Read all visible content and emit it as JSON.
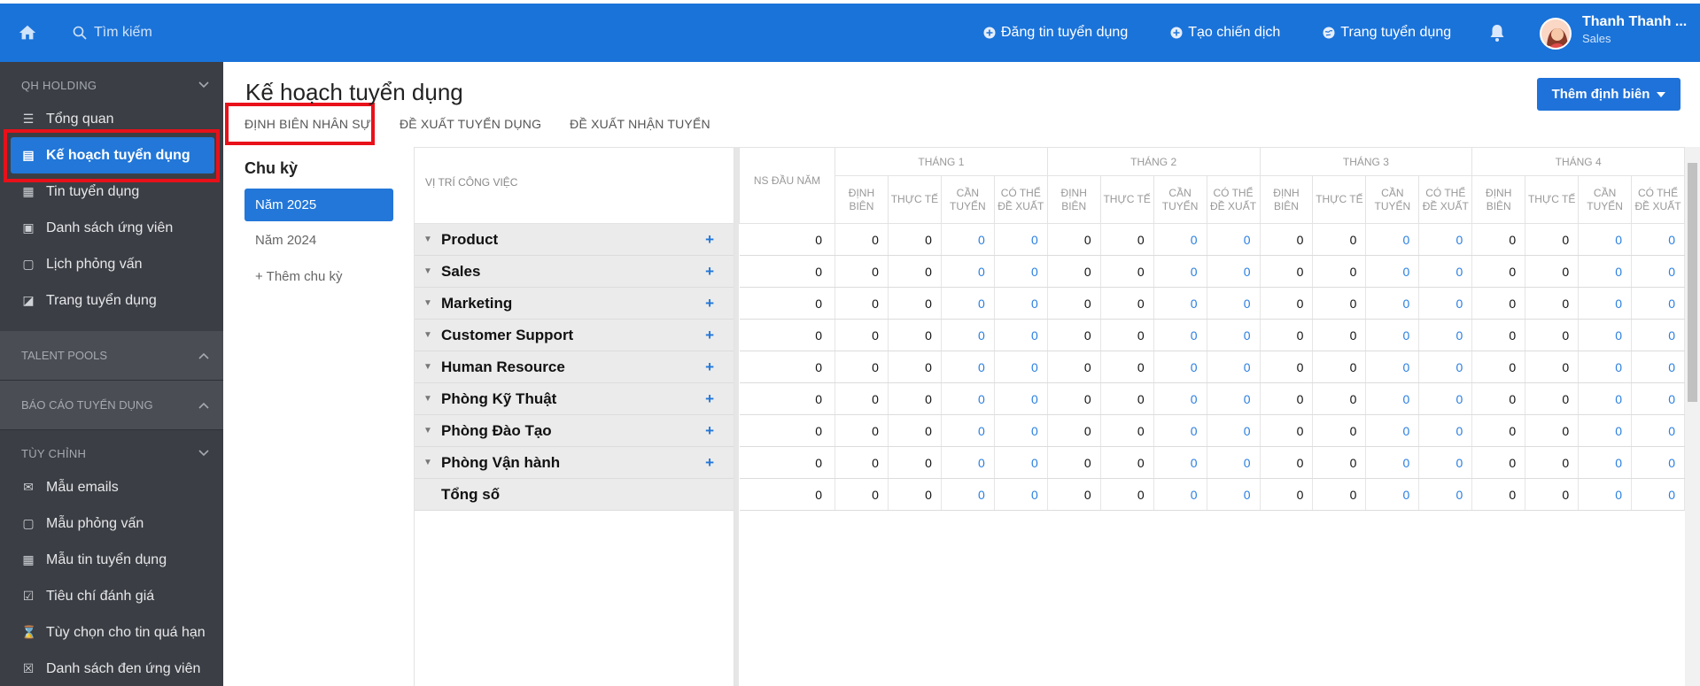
{
  "topbar": {
    "search_placeholder": "Tìm kiếm",
    "actions": [
      "Đăng tin tuyển dụng",
      "Tạo chiến dịch",
      "Trang tuyển dụng"
    ],
    "user_name": "Thanh Thanh ...",
    "user_role": "Sales"
  },
  "sidebar": {
    "group1": "QH HOLDING",
    "items1": [
      {
        "label": "Tổng quan",
        "icon": "list-icon"
      },
      {
        "label": "Kế hoạch tuyển dụng",
        "icon": "plan-icon"
      },
      {
        "label": "Tin tuyển dụng",
        "icon": "grid-icon"
      },
      {
        "label": "Danh sách ứng viên",
        "icon": "contact-icon"
      },
      {
        "label": "Lịch phỏng vấn",
        "icon": "calendar-icon"
      },
      {
        "label": "Trang tuyển dụng",
        "icon": "edit-icon"
      }
    ],
    "group2": "TALENT POOLS",
    "group3": "BÁO CÁO TUYỂN DỤNG",
    "group4": "TÙY CHỈNH",
    "items2": [
      {
        "label": "Mẫu emails",
        "icon": "mail-icon"
      },
      {
        "label": "Mẫu phỏng vấn",
        "icon": "calendar-check-icon"
      },
      {
        "label": "Mẫu tin tuyển dụng",
        "icon": "apps-icon"
      },
      {
        "label": "Tiêu chí đánh giá",
        "icon": "checkbox-icon"
      },
      {
        "label": "Tùy chọn cho tin quá hạn",
        "icon": "hourglass-icon"
      },
      {
        "label": "Danh sách đen ứng viên",
        "icon": "block-icon"
      }
    ]
  },
  "main": {
    "title": "Kế hoạch tuyển dụng",
    "add_button": "Thêm định biên",
    "tabs": [
      "ĐỊNH BIÊN NHÂN SỰ",
      "ĐỀ XUẤT TUYỂN DỤNG",
      "ĐỀ XUẤT NHẬN TUYỂN"
    ],
    "cycle_title": "Chu kỳ",
    "cycles": [
      "Năm 2025",
      "Năm 2024",
      "+ Thêm chu kỳ"
    ]
  },
  "table": {
    "position_header": "VỊ TRÍ CÔNG VIỆC",
    "ns_header": "NS ĐẦU NĂM",
    "months": [
      "THÁNG 1",
      "THÁNG 2",
      "THÁNG 3",
      "THÁNG 4"
    ],
    "sub_headers": [
      "ĐỊNH BIÊN",
      "THỰC TẾ",
      "CẦN TUYỂN",
      "CÓ THỂ ĐỀ XUẤT"
    ],
    "rows": [
      {
        "name": "Product",
        "ns": "0",
        "values": [
          "0",
          "0",
          "0",
          "0",
          "0",
          "0",
          "0",
          "0",
          "0",
          "0",
          "0",
          "0",
          "0",
          "0",
          "0",
          "0"
        ]
      },
      {
        "name": "Sales",
        "ns": "0",
        "values": [
          "0",
          "0",
          "0",
          "0",
          "0",
          "0",
          "0",
          "0",
          "0",
          "0",
          "0",
          "0",
          "0",
          "0",
          "0",
          "0"
        ]
      },
      {
        "name": "Marketing",
        "ns": "0",
        "values": [
          "0",
          "0",
          "0",
          "0",
          "0",
          "0",
          "0",
          "0",
          "0",
          "0",
          "0",
          "0",
          "0",
          "0",
          "0",
          "0"
        ]
      },
      {
        "name": "Customer Support",
        "ns": "0",
        "values": [
          "0",
          "0",
          "0",
          "0",
          "0",
          "0",
          "0",
          "0",
          "0",
          "0",
          "0",
          "0",
          "0",
          "0",
          "0",
          "0"
        ]
      },
      {
        "name": "Human Resource",
        "ns": "0",
        "values": [
          "0",
          "0",
          "0",
          "0",
          "0",
          "0",
          "0",
          "0",
          "0",
          "0",
          "0",
          "0",
          "0",
          "0",
          "0",
          "0"
        ]
      },
      {
        "name": "Phòng Kỹ Thuật",
        "ns": "0",
        "values": [
          "0",
          "0",
          "0",
          "0",
          "0",
          "0",
          "0",
          "0",
          "0",
          "0",
          "0",
          "0",
          "0",
          "0",
          "0",
          "0"
        ]
      },
      {
        "name": "Phòng Đào Tạo",
        "ns": "0",
        "values": [
          "0",
          "0",
          "0",
          "0",
          "0",
          "0",
          "0",
          "0",
          "0",
          "0",
          "0",
          "0",
          "0",
          "0",
          "0",
          "0"
        ]
      },
      {
        "name": "Phòng Vận hành",
        "ns": "0",
        "values": [
          "0",
          "0",
          "0",
          "0",
          "0",
          "0",
          "0",
          "0",
          "0",
          "0",
          "0",
          "0",
          "0",
          "0",
          "0",
          "0"
        ]
      }
    ],
    "total": {
      "name": "Tổng số",
      "ns": "0",
      "values": [
        "0",
        "0",
        "0",
        "0",
        "0",
        "0",
        "0",
        "0",
        "0",
        "0",
        "0",
        "0",
        "0",
        "0",
        "0",
        "0"
      ]
    }
  },
  "colors": {
    "primary": "#1a73d9",
    "sidebar": "#3b3e44",
    "highlight": "#e8111a",
    "link": "#2a7fe0"
  }
}
